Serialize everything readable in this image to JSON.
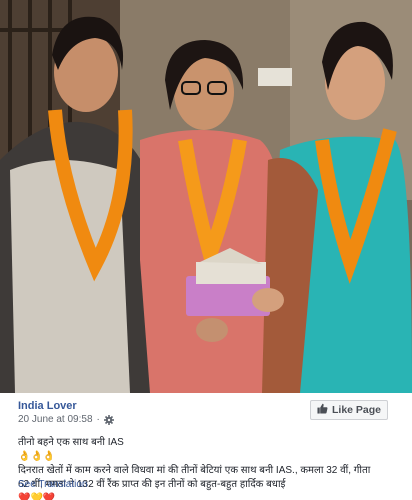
{
  "post": {
    "author": "India Lover",
    "timestamp": "20 June at 09:58",
    "separator": "·",
    "audience_icon": "gear-icon",
    "like_page_label": "Like Page",
    "caption_line1": "तीनो बहने एक साथ बनी IAS",
    "caption_line1_emoji": "👌👌👌",
    "caption_line2": "दिनरात खेतों में काम करने वाले विधवा मां की तीनों बेटियां एक साथ बनी IAS., कमला 32 वीं, गीता",
    "caption_line3": "62 वीं, ममता ने 132 वीं रैंक प्राप्त की इन तीनों को बहुत-बहुत हार्दिक बधाई",
    "caption_line3_emoji": "❤️💛❤️",
    "see_translation": "See Translation"
  },
  "colors": {
    "link_blue": "#365899",
    "meta_gray": "#616770",
    "text": "#1d2129"
  }
}
